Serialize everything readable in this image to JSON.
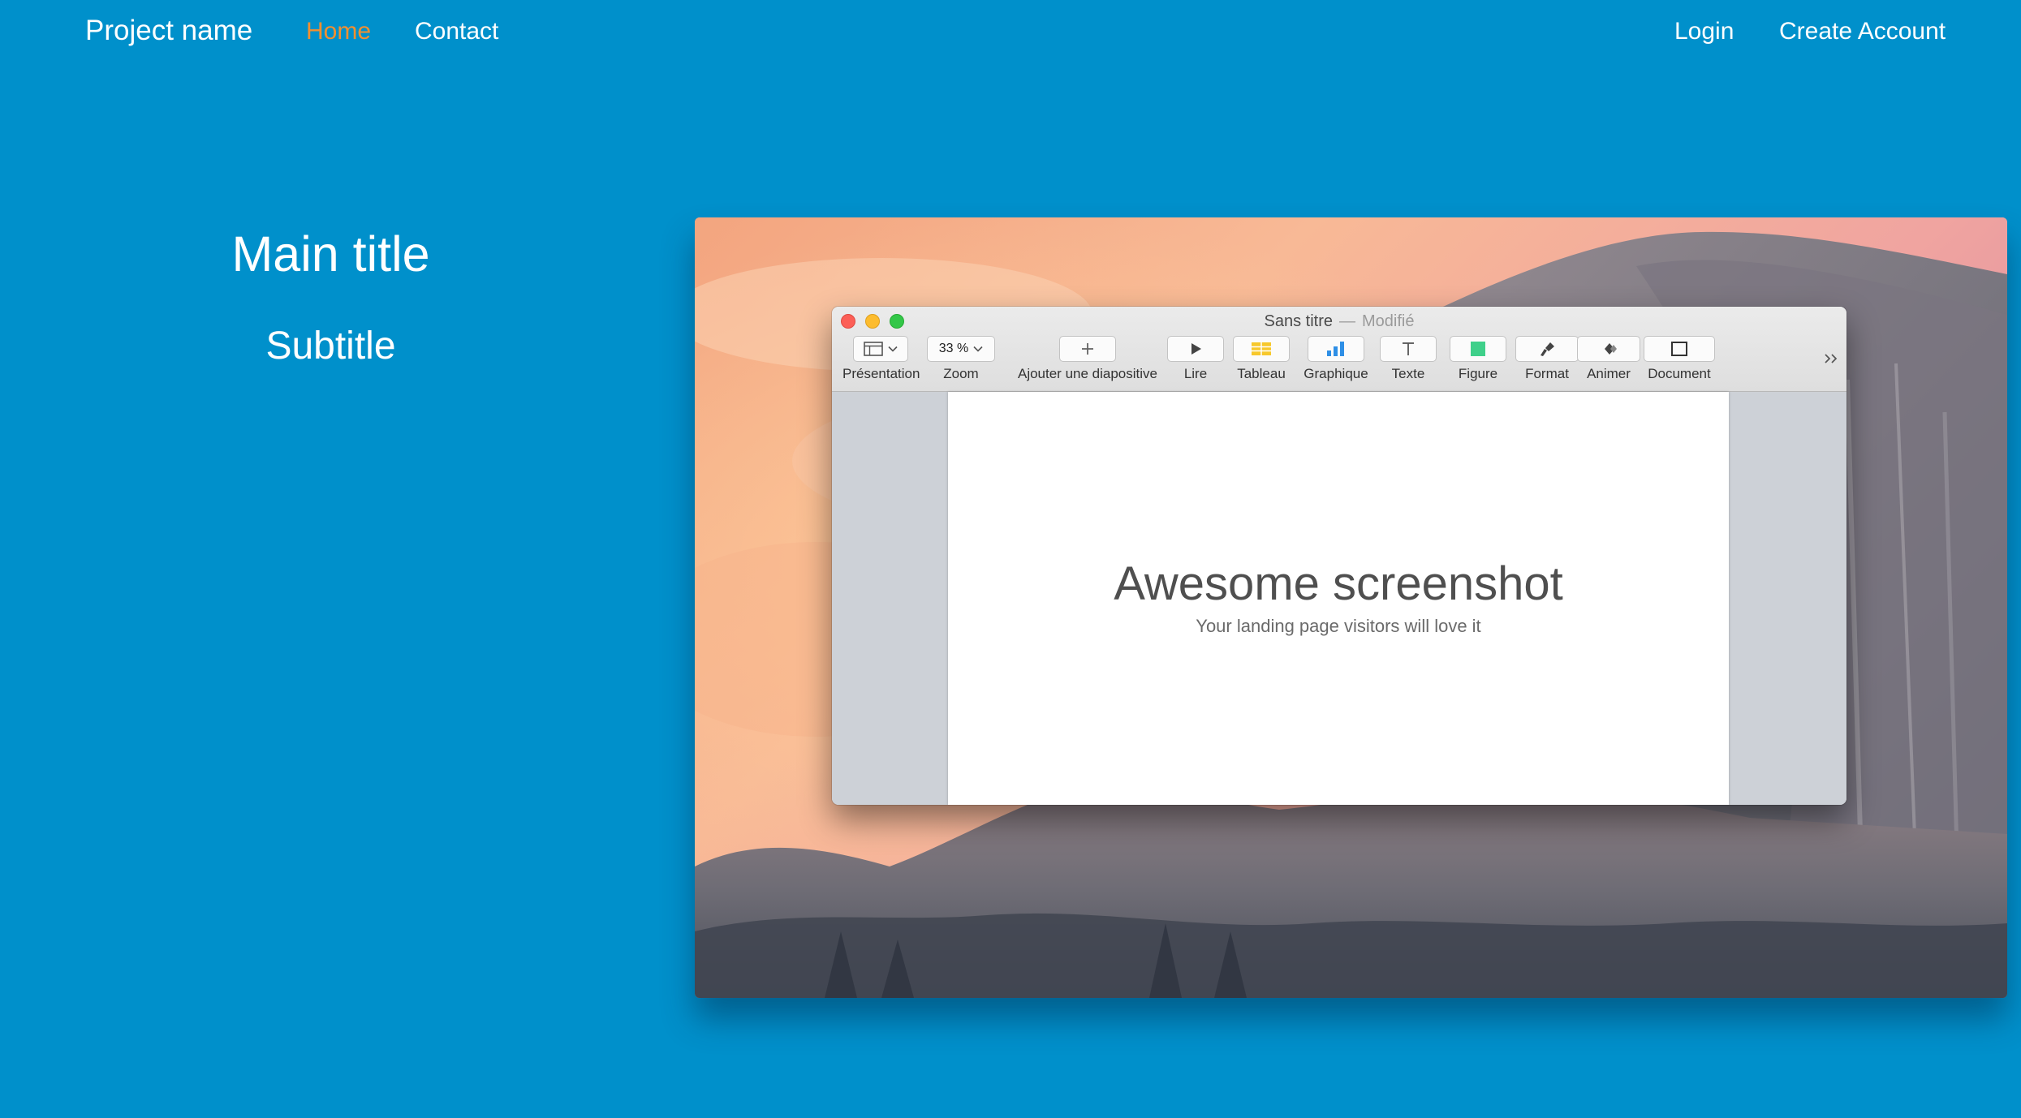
{
  "navbar": {
    "brand": "Project name",
    "links": [
      {
        "label": "Home",
        "active": true
      },
      {
        "label": "Contact",
        "active": false
      }
    ],
    "right_links": [
      {
        "label": "Login"
      },
      {
        "label": "Create Account"
      }
    ]
  },
  "hero": {
    "title": "Main title",
    "subtitle": "Subtitle"
  },
  "app_window": {
    "title": "Sans titre",
    "separator": "—",
    "status": "Modifié",
    "toolbar": {
      "presentation_label": "Présentation",
      "zoom_value": "33 %",
      "zoom_label": "Zoom",
      "add_slide_label": "Ajouter une diapositive",
      "play_label": "Lire",
      "table_label": "Tableau",
      "chart_label": "Graphique",
      "text_label": "Texte",
      "shape_label": "Figure",
      "format_label": "Format",
      "animate_label": "Animer",
      "document_label": "Document",
      "more_icon": "chevron-double-right-icon"
    },
    "slide": {
      "title": "Awesome screenshot",
      "subtitle": "Your landing page visitors will love it"
    }
  },
  "colors": {
    "page_background": "#0090cb",
    "nav_active": "#f38f2f",
    "text": "#ffffff"
  }
}
